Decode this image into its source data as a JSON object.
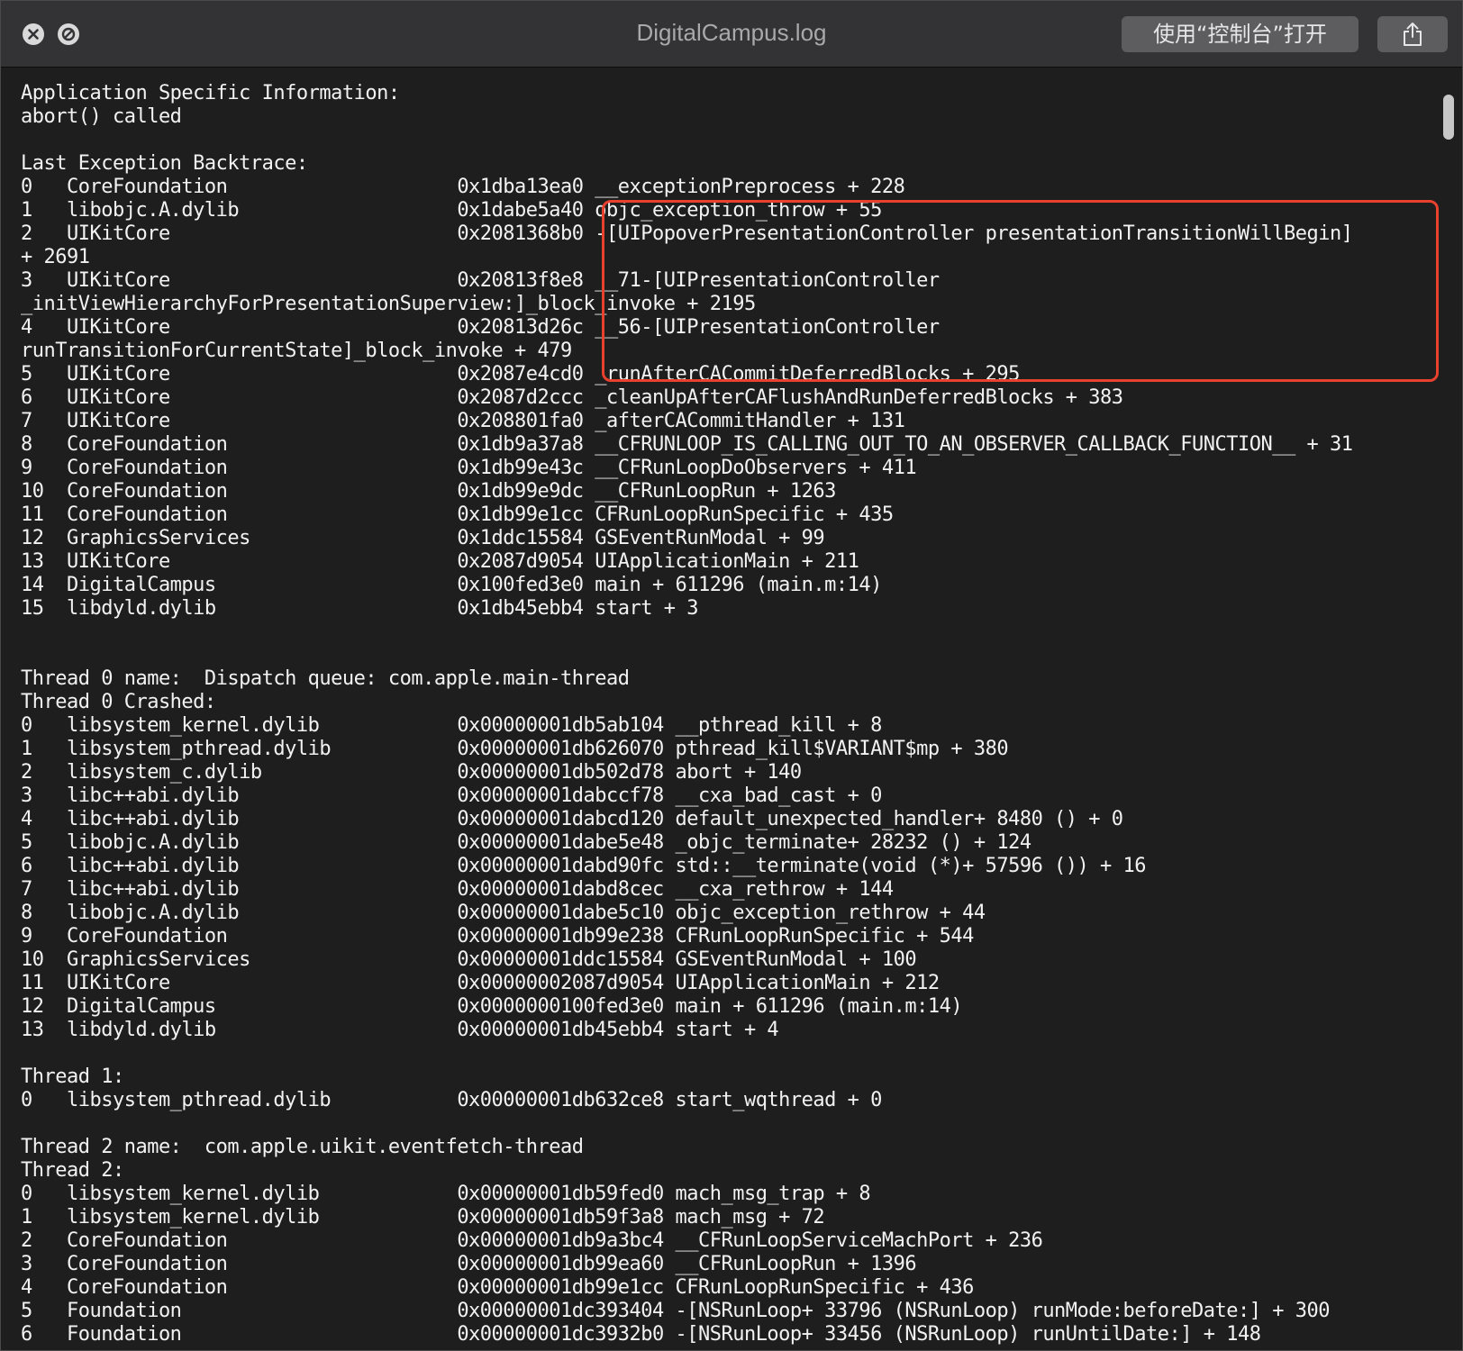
{
  "window": {
    "title": "DigitalCampus.log",
    "open_in_console_label": "使用“控制台”打开"
  },
  "icons": {
    "close": "close-icon",
    "minimize": "minimize-disabled-icon",
    "share": "share-icon"
  },
  "colors": {
    "highlight_box": "#e8412e",
    "titlebar": "#333335",
    "background": "#1e1e1e"
  },
  "log_text": "Application Specific Information:\nabort() called\n\nLast Exception Backtrace:\n0   CoreFoundation                    0x1dba13ea0 __exceptionPreprocess + 228\n1   libobjc.A.dylib                   0x1dabe5a40 objc_exception_throw + 55\n2   UIKitCore                         0x2081368b0 -[UIPopoverPresentationController presentationTransitionWillBegin]\n+ 2691\n3   UIKitCore                         0x20813f8e8 __71-[UIPresentationController\n_initViewHierarchyForPresentationSuperview:]_block_invoke + 2195\n4   UIKitCore                         0x20813d26c __56-[UIPresentationController\nrunTransitionForCurrentState]_block_invoke + 479\n5   UIKitCore                         0x2087e4cd0 _runAfterCACommitDeferredBlocks + 295\n6   UIKitCore                         0x2087d2ccc _cleanUpAfterCAFlushAndRunDeferredBlocks + 383\n7   UIKitCore                         0x208801fa0 _afterCACommitHandler + 131\n8   CoreFoundation                    0x1db9a37a8 __CFRUNLOOP_IS_CALLING_OUT_TO_AN_OBSERVER_CALLBACK_FUNCTION__ + 31\n9   CoreFoundation                    0x1db99e43c __CFRunLoopDoObservers + 411\n10  CoreFoundation                    0x1db99e9dc __CFRunLoopRun + 1263\n11  CoreFoundation                    0x1db99e1cc CFRunLoopRunSpecific + 435\n12  GraphicsServices                  0x1ddc15584 GSEventRunModal + 99\n13  UIKitCore                         0x2087d9054 UIApplicationMain + 211\n14  DigitalCampus                     0x100fed3e0 main + 611296 (main.m:14)\n15  libdyld.dylib                     0x1db45ebb4 start + 3\n\n\nThread 0 name:  Dispatch queue: com.apple.main-thread\nThread 0 Crashed:\n0   libsystem_kernel.dylib            0x00000001db5ab104 __pthread_kill + 8\n1   libsystem_pthread.dylib           0x00000001db626070 pthread_kill$VARIANT$mp + 380\n2   libsystem_c.dylib                 0x00000001db502d78 abort + 140\n3   libc++abi.dylib                   0x00000001dabccf78 __cxa_bad_cast + 0\n4   libc++abi.dylib                   0x00000001dabcd120 default_unexpected_handler+ 8480 () + 0\n5   libobjc.A.dylib                   0x00000001dabe5e48 _objc_terminate+ 28232 () + 124\n6   libc++abi.dylib                   0x00000001dabd90fc std::__terminate(void (*)+ 57596 ()) + 16\n7   libc++abi.dylib                   0x00000001dabd8cec __cxa_rethrow + 144\n8   libobjc.A.dylib                   0x00000001dabe5c10 objc_exception_rethrow + 44\n9   CoreFoundation                    0x00000001db99e238 CFRunLoopRunSpecific + 544\n10  GraphicsServices                  0x00000001ddc15584 GSEventRunModal + 100\n11  UIKitCore                         0x00000002087d9054 UIApplicationMain + 212\n12  DigitalCampus                     0x0000000100fed3e0 main + 611296 (main.m:14)\n13  libdyld.dylib                     0x00000001db45ebb4 start + 4\n\nThread 1:\n0   libsystem_pthread.dylib           0x00000001db632ce8 start_wqthread + 0\n\nThread 2 name:  com.apple.uikit.eventfetch-thread\nThread 2:\n0   libsystem_kernel.dylib            0x00000001db59fed0 mach_msg_trap + 8\n1   libsystem_kernel.dylib            0x00000001db59f3a8 mach_msg + 72\n2   CoreFoundation                    0x00000001db9a3bc4 __CFRunLoopServiceMachPort + 236\n3   CoreFoundation                    0x00000001db99ea60 __CFRunLoopRun + 1396\n4   CoreFoundation                    0x00000001db99e1cc CFRunLoopRunSpecific + 436\n5   Foundation                        0x00000001dc393404 -[NSRunLoop+ 33796 (NSRunLoop) runMode:beforeDate:] + 300\n6   Foundation                        0x00000001dc3932b0 -[NSRunLoop+ 33456 (NSRunLoop) runUntilDate:] + 148"
}
